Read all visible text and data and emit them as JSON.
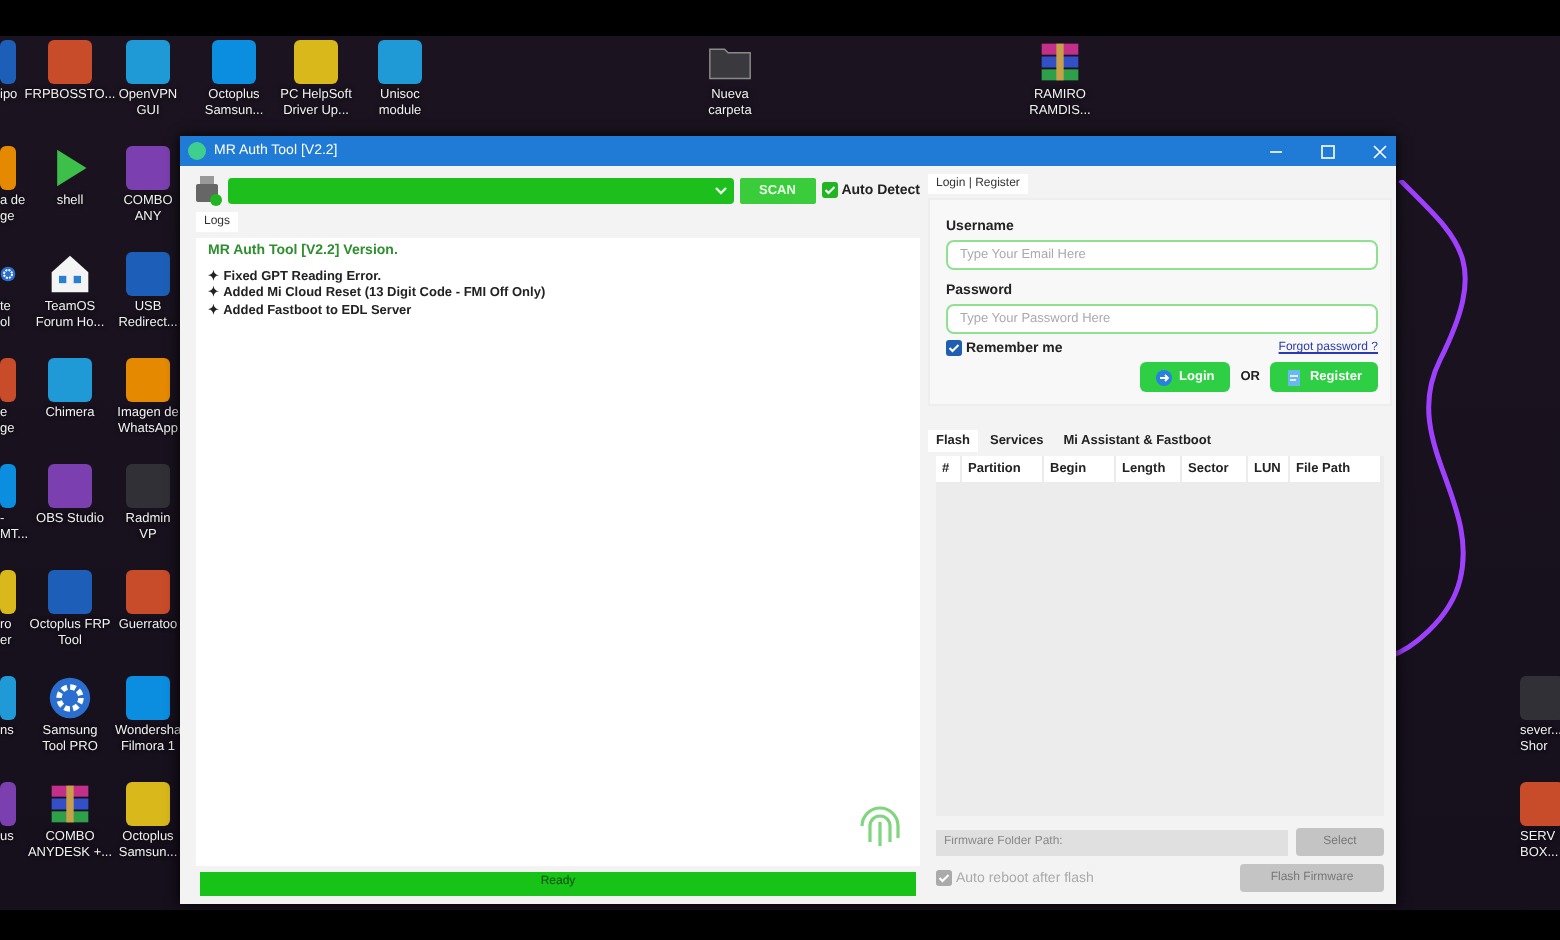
{
  "desktop": {
    "columns": [
      [
        {
          "label": "ipo",
          "kind": "app"
        },
        {
          "label": "a de\nge",
          "kind": "app"
        },
        {
          "label": "te\nol",
          "kind": "gear"
        },
        {
          "label": "e\nge",
          "kind": "app"
        },
        {
          "label": "-\nMT...",
          "kind": "app"
        },
        {
          "label": "ro\ner",
          "kind": "app"
        },
        {
          "label": "ns",
          "kind": "app"
        },
        {
          "label": "us",
          "kind": "app"
        }
      ],
      [
        {
          "label": "FRPBOSSTO...",
          "kind": "app"
        },
        {
          "label": "shell",
          "kind": "play"
        },
        {
          "label": "TeamOS\nForum Ho...",
          "kind": "house"
        },
        {
          "label": "Chimera",
          "kind": "app"
        },
        {
          "label": "OBS Studio",
          "kind": "app"
        },
        {
          "label": "Octoplus FRP\nTool",
          "kind": "app"
        },
        {
          "label": "Samsung\nTool PRO",
          "kind": "gear"
        },
        {
          "label": "COMBO\nANYDESK +...",
          "kind": "archive"
        }
      ],
      [
        {
          "label": "OpenVPN\nGUI",
          "kind": "app"
        },
        {
          "label": "COMBO\nANY",
          "kind": "app"
        },
        {
          "label": "USB\nRedirect...",
          "kind": "app"
        },
        {
          "label": "Imagen de\nWhatsApp",
          "kind": "app"
        },
        {
          "label": "Radmin VP",
          "kind": "app"
        },
        {
          "label": "Guerratoo",
          "kind": "app"
        },
        {
          "label": "Wondersha\nFilmora 1",
          "kind": "app"
        },
        {
          "label": "Octoplus\nSamsun...",
          "kind": "app"
        }
      ]
    ],
    "top_row": [
      {
        "label": "Octoplus\nSamsun...",
        "kind": "app"
      },
      {
        "label": "PC HelpSoft\nDriver Up...",
        "kind": "app"
      },
      {
        "label": "Unisoc\nmodule",
        "kind": "app"
      },
      {
        "label": "Nueva\ncarpeta",
        "kind": "folder"
      },
      {
        "label": "RAMIRO\nRAMDIS...",
        "kind": "archive"
      }
    ],
    "right_column": [
      {
        "label": "sever...\nShor",
        "kind": "app"
      },
      {
        "label": "SERV\nBOX...",
        "kind": "app"
      }
    ]
  },
  "window": {
    "title": "MR Auth Tool [V2.2]"
  },
  "device_bar": {
    "scan_button": "SCAN",
    "auto_detect": {
      "label": "Auto Detect",
      "checked": true
    }
  },
  "logs": {
    "tab": "Logs",
    "title": "MR Auth Tool [V2.2] Version.",
    "lines": [
      "✦ Fixed GPT Reading Error.",
      "✦ Added Mi Cloud Reset (13 Digit Code - FMI Off Only)",
      "✦ Added Fastboot to EDL Server"
    ]
  },
  "progress": {
    "label": "Ready",
    "level": 1
  },
  "login": {
    "tab": "Login | Register",
    "username": {
      "label": "Username",
      "placeholder": "Type Your Email Here"
    },
    "password": {
      "label": "Password",
      "placeholder": "Type Your Password Here"
    },
    "remember": {
      "label": "Remember me",
      "checked": true
    },
    "forgot_link": "Forgot password ?",
    "login_button": "Login",
    "or": "OR",
    "register_button": "Register"
  },
  "flash_tabs": [
    {
      "label": "Flash",
      "selected": true
    },
    {
      "label": "Services",
      "selected": false
    },
    {
      "label": "Mi Assistant  & Fastboot",
      "selected": false
    }
  ],
  "table": {
    "columns": [
      "#",
      "Partition",
      "Begin",
      "Length",
      "Sector",
      "LUN",
      "File Path"
    ]
  },
  "firmware": {
    "path": {
      "placeholder": "Firmware Folder Path:"
    },
    "select_button": {
      "label": "Select",
      "disabled": true
    },
    "auto_reboot": {
      "label": "Auto reboot after flash",
      "checked": true,
      "disabled": true
    },
    "flash_button": {
      "label": "Flash Firmware",
      "disabled": true
    }
  }
}
